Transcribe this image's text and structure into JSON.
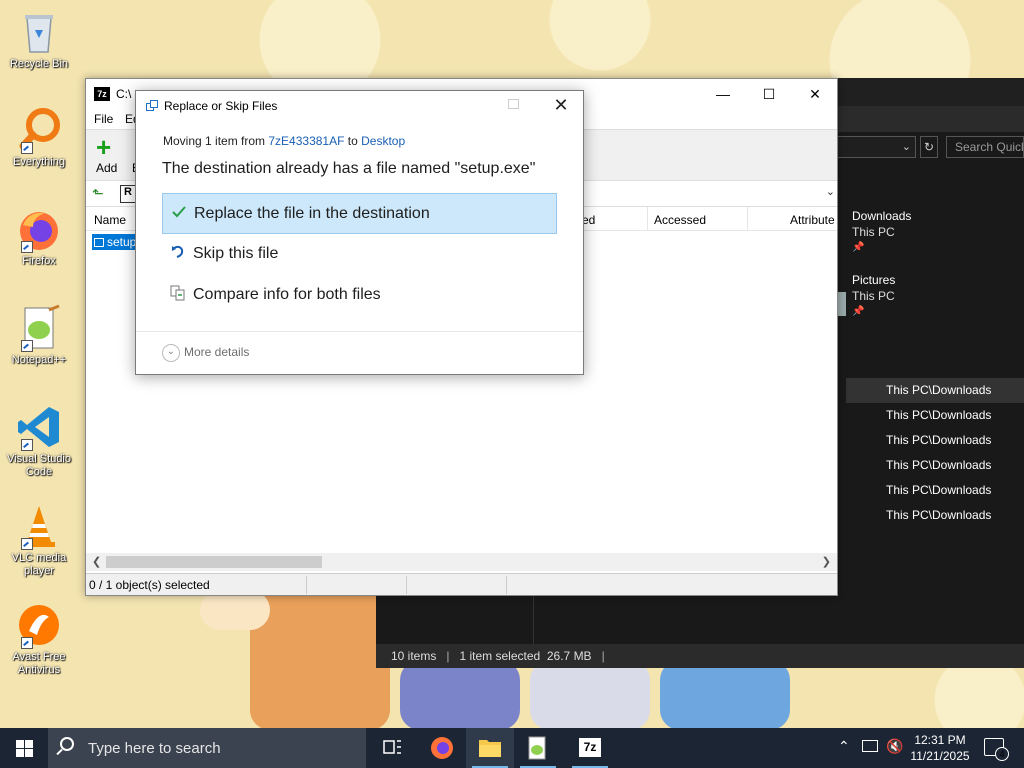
{
  "desktop": {
    "icons": [
      {
        "label": "Recycle Bin"
      },
      {
        "label": "Everything"
      },
      {
        "label": "Firefox"
      },
      {
        "label": "Notepad++"
      },
      {
        "label": "Visual Studio Code"
      },
      {
        "label": "VLC media player"
      },
      {
        "label": "Avast Free Antivirus"
      }
    ]
  },
  "explorer": {
    "search_placeholder": "Search Quick",
    "quick_access": [
      {
        "name": "Downloads",
        "location": "This PC"
      },
      {
        "name": "Pictures",
        "location": "This PC"
      }
    ],
    "recent_paths": [
      "This PC\\Downloads",
      "This PC\\Downloads",
      "This PC\\Downloads",
      "This PC\\Downloads",
      "This PC\\Downloads",
      "This PC\\Downloads"
    ],
    "status": {
      "items": "10 items",
      "selected": "1 item selected",
      "size": "26.7 MB"
    }
  },
  "sevenzip": {
    "title": "C:\\",
    "menu": {
      "file": "File",
      "edit": "Ed"
    },
    "toolbar": {
      "add": "Add",
      "extract": "E"
    },
    "address_value": "R",
    "columns": {
      "name": "Name",
      "modified": "ed",
      "accessed": "Accessed",
      "attributes": "Attribute"
    },
    "selected_file": "setup",
    "status": "0 / 1 object(s) selected"
  },
  "dialog": {
    "title": "Replace or Skip Files",
    "moving_prefix": "Moving 1 item from ",
    "source": "7zE433381AF",
    "to_word": " to ",
    "destination": "Desktop",
    "message": "The destination already has a file named \"setup.exe\"",
    "options": {
      "replace": "Replace the file in the destination",
      "skip": "Skip this file",
      "compare": "Compare info for both files"
    },
    "more_details": "More details"
  },
  "taskbar": {
    "search_placeholder": "Type here to search",
    "time": "12:31 PM",
    "date": "11/21/2025",
    "notifications": "4",
    "sevenzip_label": "7z"
  },
  "colors": {
    "accent": "#0078d7",
    "dialog_highlight": "#cce8fa",
    "taskbar": "#1c2533",
    "link": "#1a5fb4"
  }
}
